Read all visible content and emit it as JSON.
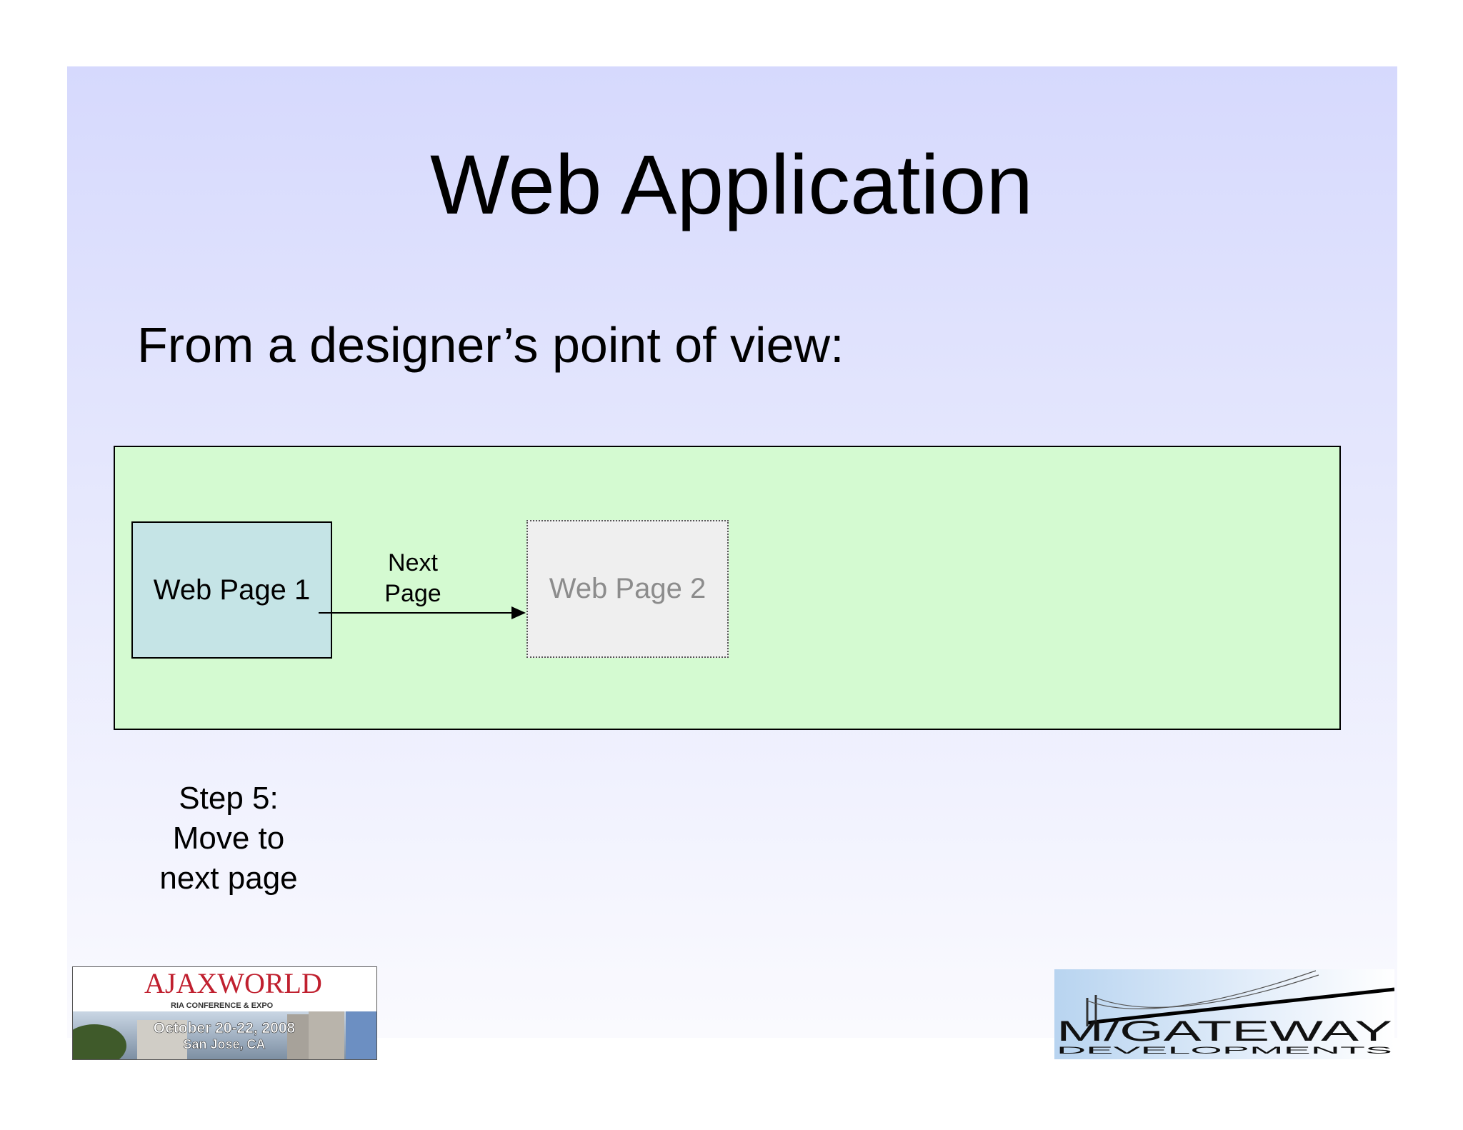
{
  "slide": {
    "title": "Web Application",
    "subtitle": "From a designer’s point of view:"
  },
  "diagram": {
    "page_1_label": "Web Page 1",
    "page_2_label": "Web Page 2",
    "transition_line_1": "Next",
    "transition_line_2": "Page"
  },
  "step": {
    "line_1": "Step 5:",
    "line_2": "Move to",
    "line_3": "next page"
  },
  "logos": {
    "ajaxworld": {
      "brand": "AJAXWORLD",
      "tagline": "RIA CONFERENCE & EXPO",
      "dates": "October 20-22, 2008",
      "location": "San Jose, CA"
    },
    "mgateway": {
      "brand": "M/GATEWAY",
      "subbrand": "DEVELOPMENTS"
    }
  },
  "colors": {
    "slide_gradient_top": "#d6d9fd",
    "slide_gradient_bottom": "#fafafe",
    "diagram_area": "#d4fad1",
    "page_1_fill": "#c5e4e6",
    "page_2_fill": "#efefef",
    "page_2_text": "#8c8c8c"
  }
}
